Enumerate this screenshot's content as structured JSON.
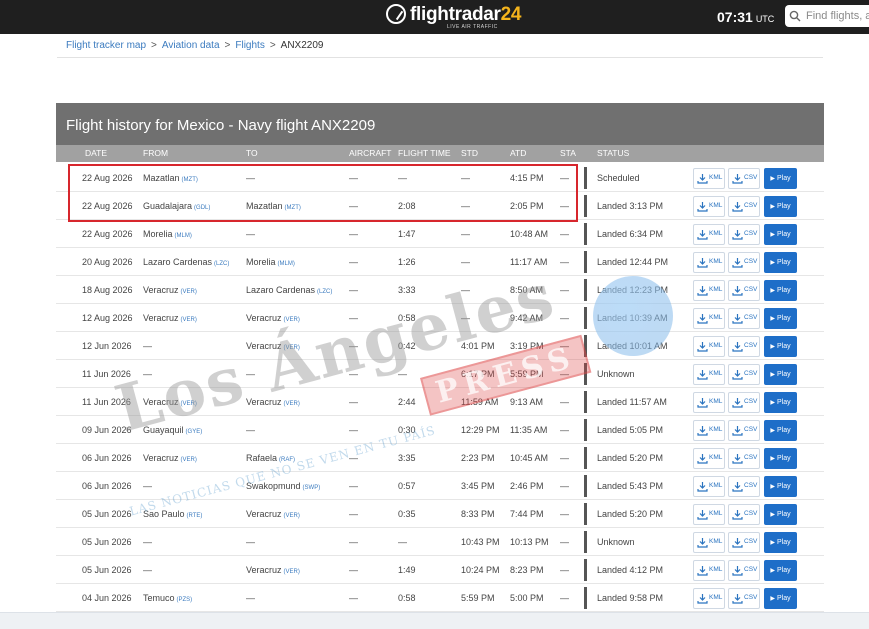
{
  "topbar": {
    "logo_text": "flightradar",
    "logo_num": "24",
    "logo_sub": "LIVE AIR TRAFFIC",
    "clock": "07:31",
    "timezone": "UTC",
    "search_placeholder": "Find flights, air"
  },
  "breadcrumb": {
    "items": [
      "Flight tracker map",
      "Aviation data",
      "Flights"
    ],
    "current": "ANX2209",
    "separator": ">"
  },
  "panel": {
    "title": "Flight history for Mexico - Navy flight ANX2209"
  },
  "columns": [
    "DATE",
    "FROM",
    "TO",
    "AIRCRAFT",
    "FLIGHT TIME",
    "STD",
    "ATD",
    "STA",
    "STATUS"
  ],
  "buttons": {
    "kml": "KML",
    "csv": "CSV",
    "play": "Play"
  },
  "rows": [
    {
      "date": "22 Aug 2026",
      "from": "Mazatlan",
      "from_code": "(MZT)",
      "to": "—",
      "to_code": "",
      "aircraft": "—",
      "flight_time": "—",
      "std": "—",
      "atd": "4:15 PM",
      "sta": "—",
      "status": "Scheduled"
    },
    {
      "date": "22 Aug 2026",
      "from": "Guadalajara",
      "from_code": "(GDL)",
      "to": "Mazatlan",
      "to_code": "(MZT)",
      "aircraft": "—",
      "flight_time": "2:08",
      "std": "—",
      "atd": "2:05 PM",
      "sta": "—",
      "status": "Landed 3:13 PM"
    },
    {
      "date": "22 Aug 2026",
      "from": "Morelia",
      "from_code": "(MLM)",
      "to": "—",
      "to_code": "",
      "aircraft": "—",
      "flight_time": "1:47",
      "std": "—",
      "atd": "10:48 AM",
      "sta": "—",
      "status": "Landed 6:34 PM"
    },
    {
      "date": "20 Aug 2026",
      "from": "Lazaro Cardenas",
      "from_code": "(LZC)",
      "to": "Morelia",
      "to_code": "(MLM)",
      "aircraft": "—",
      "flight_time": "1:26",
      "std": "—",
      "atd": "11:17 AM",
      "sta": "—",
      "status": "Landed 12:44 PM"
    },
    {
      "date": "18 Aug 2026",
      "from": "Veracruz",
      "from_code": "(VER)",
      "to": "Lazaro Cardenas",
      "to_code": "(LZC)",
      "aircraft": "—",
      "flight_time": "3:33",
      "std": "—",
      "atd": "8:50 AM",
      "sta": "—",
      "status": "Landed 12:23 PM"
    },
    {
      "date": "12 Aug 2026",
      "from": "Veracruz",
      "from_code": "(VER)",
      "to": "Veracruz",
      "to_code": "(VER)",
      "aircraft": "—",
      "flight_time": "0:58",
      "std": "—",
      "atd": "9:42 AM",
      "sta": "—",
      "status": "Landed 10:39 AM"
    },
    {
      "date": "12 Jun 2026",
      "from": "—",
      "from_code": "",
      "to": "Veracruz",
      "to_code": "(VER)",
      "aircraft": "—",
      "flight_time": "0:42",
      "std": "4:01 PM",
      "atd": "3:19 PM",
      "sta": "—",
      "status": "Landed 10:01 AM"
    },
    {
      "date": "11 Jun 2026",
      "from": "—",
      "from_code": "",
      "to": "—",
      "to_code": "",
      "aircraft": "—",
      "flight_time": "—",
      "std": "6:17 PM",
      "atd": "5:59 PM",
      "sta": "—",
      "status": "Unknown"
    },
    {
      "date": "11 Jun 2026",
      "from": "Veracruz",
      "from_code": "(VER)",
      "to": "Veracruz",
      "to_code": "(VER)",
      "aircraft": "—",
      "flight_time": "2:44",
      "std": "11:59 AM",
      "atd": "9:13 AM",
      "sta": "—",
      "status": "Landed 11:57 AM"
    },
    {
      "date": "09 Jun 2026",
      "from": "Guayaquil",
      "from_code": "(GYE)",
      "to": "—",
      "to_code": "",
      "aircraft": "—",
      "flight_time": "0:30",
      "std": "12:29 PM",
      "atd": "11:35 AM",
      "sta": "—",
      "status": "Landed 5:05 PM"
    },
    {
      "date": "06 Jun 2026",
      "from": "Veracruz",
      "from_code": "(VER)",
      "to": "Rafaela",
      "to_code": "(RAF)",
      "aircraft": "—",
      "flight_time": "3:35",
      "std": "2:23 PM",
      "atd": "10:45 AM",
      "sta": "—",
      "status": "Landed 5:20 PM"
    },
    {
      "date": "06 Jun 2026",
      "from": "—",
      "from_code": "",
      "to": "Swakopmund",
      "to_code": "(SWP)",
      "aircraft": "—",
      "flight_time": "0:57",
      "std": "3:45 PM",
      "atd": "2:46 PM",
      "sta": "—",
      "status": "Landed 5:43 PM"
    },
    {
      "date": "05 Jun 2026",
      "from": "Sao Paulo",
      "from_code": "(RTE)",
      "to": "Veracruz",
      "to_code": "(VER)",
      "aircraft": "—",
      "flight_time": "0:35",
      "std": "8:33 PM",
      "atd": "7:44 PM",
      "sta": "—",
      "status": "Landed 5:20 PM"
    },
    {
      "date": "05 Jun 2026",
      "from": "—",
      "from_code": "",
      "to": "—",
      "to_code": "",
      "aircraft": "—",
      "flight_time": "—",
      "std": "10:43 PM",
      "atd": "10:13 PM",
      "sta": "—",
      "status": "Unknown"
    },
    {
      "date": "05 Jun 2026",
      "from": "—",
      "from_code": "",
      "to": "Veracruz",
      "to_code": "(VER)",
      "aircraft": "—",
      "flight_time": "1:49",
      "std": "10:24 PM",
      "atd": "8:23 PM",
      "sta": "—",
      "status": "Landed 4:12 PM"
    },
    {
      "date": "04 Jun 2026",
      "from": "Temuco",
      "from_code": "(PZS)",
      "to": "—",
      "to_code": "",
      "aircraft": "—",
      "flight_time": "0:58",
      "std": "5:59 PM",
      "atd": "5:00 PM",
      "sta": "—",
      "status": "Landed 9:58 PM"
    }
  ],
  "watermark": {
    "main": "Los Ángeles",
    "press": "PRESS",
    "tagline": "LAS NOTICIAS QUE NO SE VEN EN TU PAÍS"
  },
  "colors": {
    "topbar": "#1f1f1f",
    "panel_header": "#707070",
    "column_header": "#a1a1a1",
    "link": "#3b7bbf",
    "play_button": "#1e6ec8",
    "highlight_box": "#d7262d"
  }
}
